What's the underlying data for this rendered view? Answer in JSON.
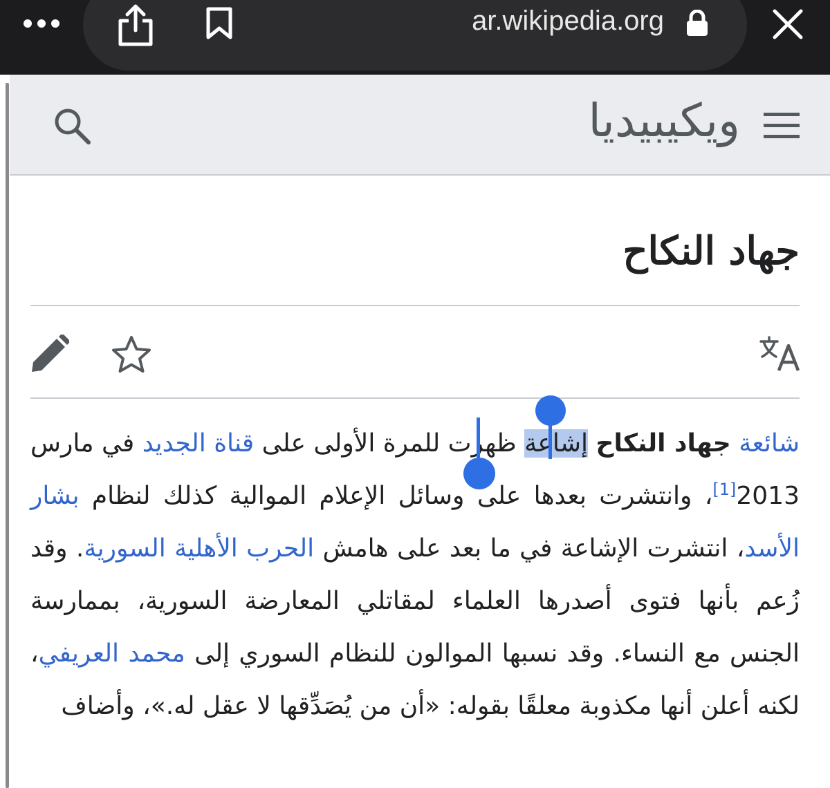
{
  "browser": {
    "url": "ar.wikipedia.org",
    "icons": [
      "more-icon",
      "share-icon",
      "bookmark-icon",
      "lock-icon",
      "close-icon"
    ]
  },
  "header": {
    "logo_text": "ويكيبيديا",
    "icons": [
      "search-icon",
      "menu-icon"
    ]
  },
  "page": {
    "title": "جهاد النكاح",
    "actions": [
      "edit-icon",
      "star-icon",
      "language-icon"
    ]
  },
  "article": {
    "link_rumor": "شائعة",
    "bold_title": "جهاد النكاح",
    "selected_word": "إشاعة",
    "t1": " ظهرت للمرة الأولى على ",
    "link_channel": "قناة الجديد",
    "t2": " في مارس 2013",
    "ref1": "[1]",
    "t3": "، وانتشرت بعدها على وسائل الإعلام الموالية كذلك لنظام ",
    "link_assad": "بشار الأسد",
    "t4": "، انتشرت الإشاعة في ما بعد على هامش ",
    "link_war": "الحرب الأهلية السورية",
    "t5": ". وقد زُعم بأنها فتوى أصدرها العلماء لمقاتلي المعارضة السورية، بممارسة الجنس مع النساء. وقد نسبها الموالون للنظام السوري إلى ",
    "link_arifi": "محمد العريفي",
    "t6": "، لكنه أعلن أنها مكذوبة معلقًا بقوله: «أن من يُصَدِّقها لا عقل له.»، وأضاف"
  },
  "colors": {
    "link": "#3366cc",
    "selection": "#b3c9ee",
    "handle": "#2f6fe4",
    "header_bg": "#eaecf0",
    "browser_bg": "#1c1c1e"
  }
}
